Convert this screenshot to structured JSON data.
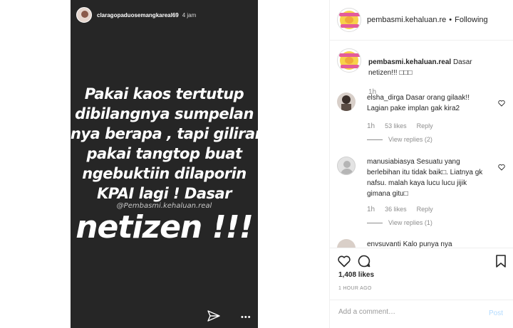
{
  "story": {
    "username": "claragopaduosemangkareal69",
    "time": "4 jam",
    "lines": [
      "Pakai kaos tertutup",
      "dibilangnya sumpelan",
      "nya berapa , tapi giliran",
      "pakai tangtop buat",
      "ngebuktiin dilaporin",
      "KPAI lagi ! Dasar"
    ],
    "watermark": "@Pembasmi.kehaluan.real",
    "big_word": "netizen !!!",
    "more": "•••"
  },
  "header": {
    "account": "pembasmi.kehaluan.re",
    "dot": "•",
    "follow_label": "Following"
  },
  "caption": {
    "account": "pembasmi.kehaluan.real",
    "text": " Dasar netizen!!! □□□",
    "time": "1h"
  },
  "comments": [
    {
      "user": "elsha_dirga",
      "text": " Dasar orang gilaak!! Lagian pake implan gak kira2",
      "time": "1h",
      "likes": "53 likes",
      "reply_label": "Reply",
      "view_replies": "View replies (2)"
    },
    {
      "user": "manusiabiasya",
      "text": " Sesuatu yang berlebihan itu tidak baik□. Liatnya gk nafsu. malah kaya lucu lucu jijik gimana gitu□",
      "time": "1h",
      "likes": "36 likes",
      "reply_label": "Reply",
      "view_replies": "View replies (1)"
    },
    {
      "user": "envsuvanti",
      "text": " Kalo punya nya"
    }
  ],
  "likes_count": "1,408 likes",
  "posted_ago": "1 HOUR AGO",
  "add_comment": {
    "placeholder": "Add a comment…",
    "post_label": "Post"
  },
  "icons": {
    "like": "heart-icon",
    "comment": "comment-icon",
    "save": "bookmark-icon",
    "share": "paper-plane-icon"
  }
}
